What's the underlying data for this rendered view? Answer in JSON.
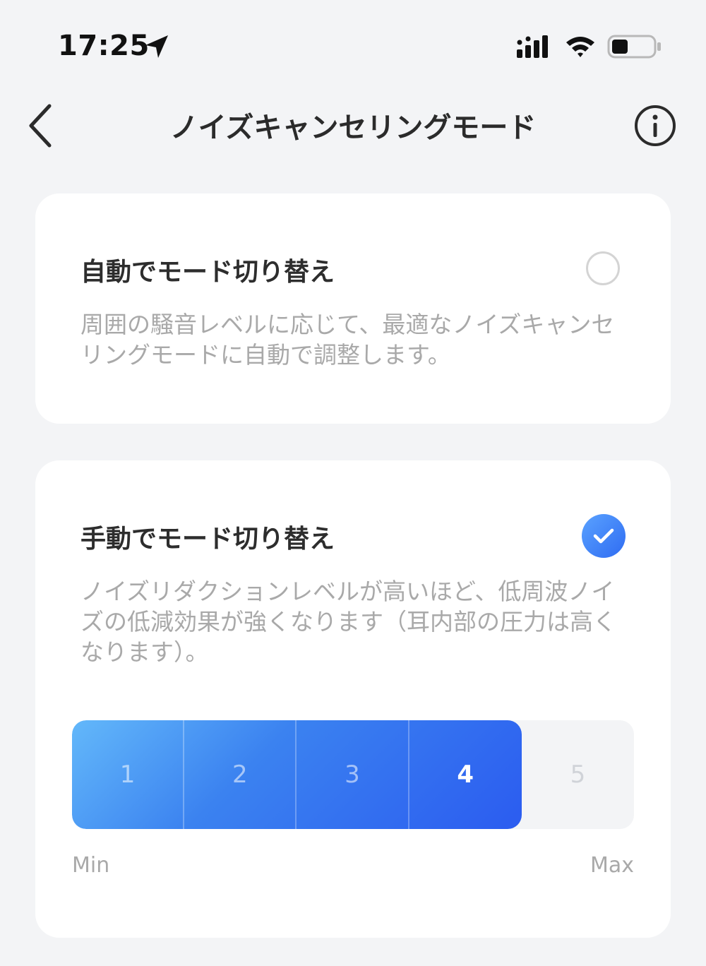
{
  "status_bar": {
    "time": "17:25",
    "icons": [
      "location-arrow-icon",
      "cellular-signal-icon",
      "wifi-icon",
      "battery-icon"
    ]
  },
  "nav": {
    "title": "ノイズキャンセリングモード",
    "icons": [
      "chevron-left-icon",
      "info-icon"
    ]
  },
  "auto_mode": {
    "title": "自動でモード切り替え",
    "description": "周囲の騒音レベルに応じて、最適なノイズキャンセリングモードに自動で調整します。",
    "selected": false
  },
  "manual_mode": {
    "title": "手動でモード切り替え",
    "description": "ノイズリダクションレベルが高いほど、低周波ノイズの低減効果が強くなります（耳内部の圧力は高くなります）。",
    "selected": true,
    "levels": [
      "1",
      "2",
      "3",
      "4",
      "5"
    ],
    "current_level": 4,
    "max_level": 5,
    "min_label": "Min",
    "max_label": "Max"
  },
  "colors": {
    "accent": "#2f6cf2",
    "accent_light": "#63b8fa",
    "background": "#f3f4f6",
    "card": "#ffffff"
  }
}
